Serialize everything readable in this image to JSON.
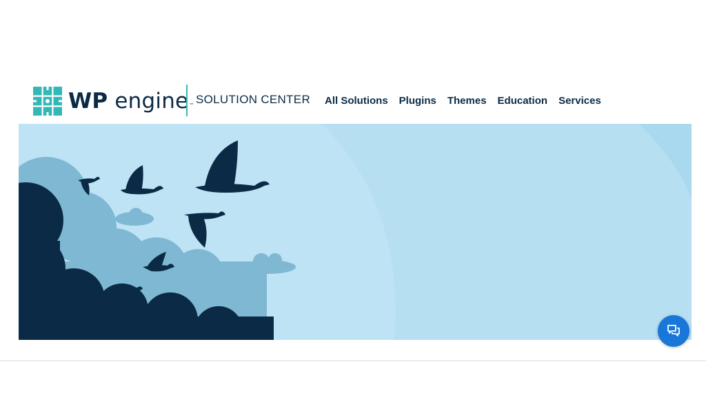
{
  "brand": {
    "logo_word_wp": "WP",
    "logo_word_engine": "engine",
    "trademark": "™",
    "section_title": "SOLUTION CENTER"
  },
  "nav": {
    "items": [
      {
        "label": "All Solutions"
      },
      {
        "label": "Plugins"
      },
      {
        "label": "Themes"
      },
      {
        "label": "Education"
      },
      {
        "label": "Services"
      }
    ]
  },
  "icons": {
    "logo": "wp-engine-grid-icon",
    "chat": "chat-bubbles-icon"
  },
  "colors": {
    "brand_teal": "#34b8b5",
    "navy": "#0b2a45",
    "hero_bg": "#bde3f4",
    "chat_blue": "#1877d9"
  }
}
